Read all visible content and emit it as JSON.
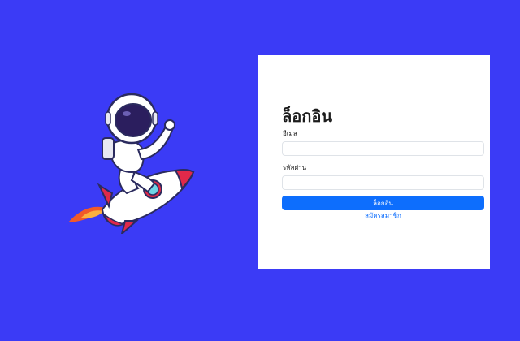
{
  "colors": {
    "background": "#3b3bf6",
    "card": "#ffffff",
    "primary": "#0d6efd",
    "field_border": "#dfe3e8"
  },
  "illustration": {
    "icon": "astronaut-on-rocket-icon"
  },
  "login": {
    "title": "ล็อกอิน",
    "email_label": "อีเมล",
    "email_value": "",
    "email_placeholder": "",
    "password_label": "รหัสผ่าน",
    "password_value": "",
    "password_placeholder": "",
    "submit_label": "ล็อกอิน",
    "register_link": "สมัครสมาชิก"
  }
}
